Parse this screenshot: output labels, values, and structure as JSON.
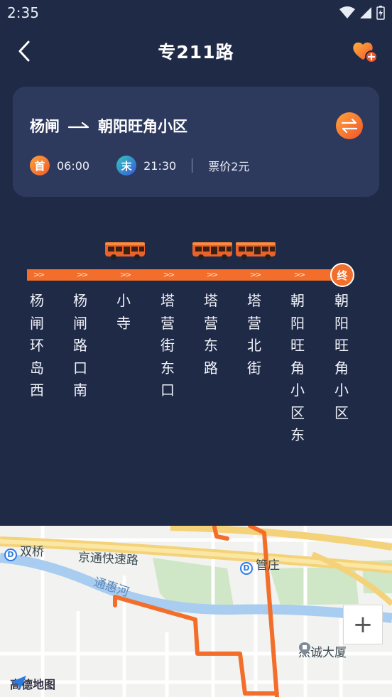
{
  "status": {
    "time": "2:35"
  },
  "header": {
    "title": "专211路"
  },
  "route": {
    "from": "杨闸",
    "to": "朝阳旺角小区",
    "first_badge": "首",
    "first_time": "06:00",
    "last_badge": "末",
    "last_time": "21:30",
    "fare": "票价2元"
  },
  "line": {
    "end_badge": "终",
    "stops": [
      "杨闸环岛西",
      "杨闸路口南",
      "小寺",
      "塔营街东口",
      "塔营东路",
      "塔营北街",
      "朝阳旺角小区东",
      "朝阳旺角小区"
    ]
  },
  "map": {
    "labels": {
      "shuangqiao": "双桥",
      "jingtong": "京通快速路",
      "guanzhuang": "管庄",
      "tonghuihe": "通惠河",
      "jiecheng": "杰诚大厦"
    },
    "subway_mark": "D",
    "zoom_in": "+",
    "logo": "高德地图"
  },
  "colors": {
    "accent": "#f26e2a",
    "background": "#1f2a47",
    "card": "#2d3a5e"
  }
}
